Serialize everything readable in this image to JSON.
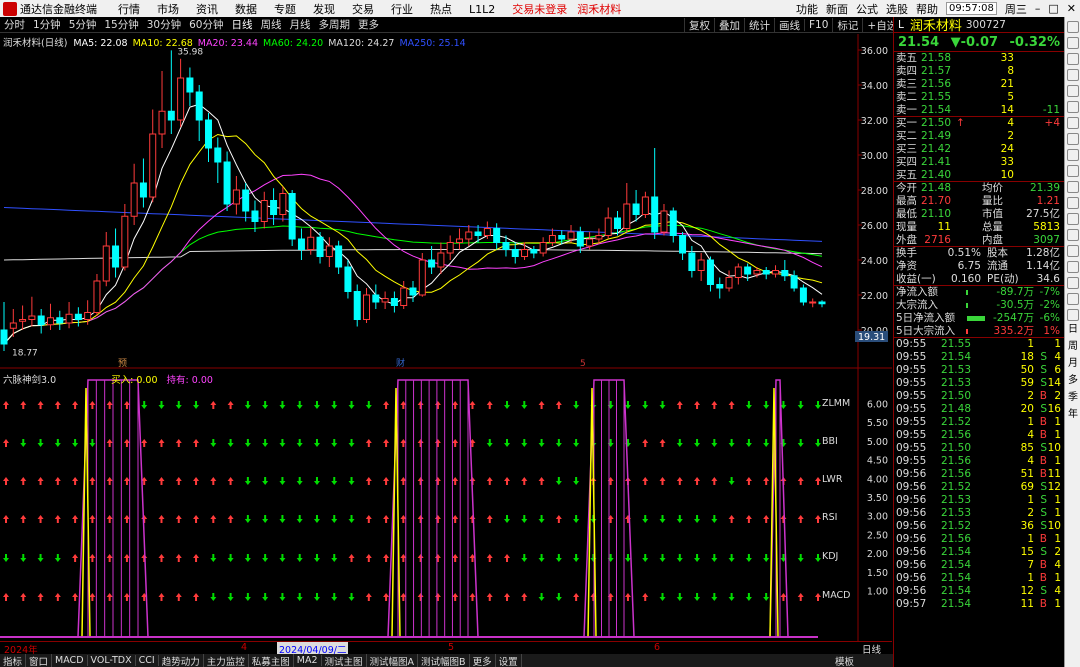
{
  "app": {
    "title": "通达信金融终端",
    "menu": [
      "行情",
      "市场",
      "资讯",
      "数据",
      "专题",
      "发现",
      "交易",
      "行业",
      "热点",
      "L1L2"
    ],
    "login": "交易未登录",
    "stock_name_top": "润禾材料",
    "right": [
      "功能",
      "新面",
      "公式",
      "选股",
      "帮助"
    ],
    "clock": "09:57:08",
    "weekday": "周三"
  },
  "toolbar": {
    "timeframes": [
      "分时",
      "1分钟",
      "5分钟",
      "15分钟",
      "30分钟",
      "60分钟",
      "日线",
      "周线",
      "月线",
      "多周期",
      "更多"
    ],
    "active": "日线",
    "right": [
      "复权",
      "叠加",
      "统计",
      "画线",
      "F10",
      "标记",
      "+自选",
      "返回"
    ]
  },
  "legend": {
    "name": "润禾材料(日线)",
    "ma": [
      {
        "label": "MA5: 22.08",
        "color": "#ffffff"
      },
      {
        "label": "MA10: 22.68",
        "color": "#ffff00"
      },
      {
        "label": "MA20: 23.44",
        "color": "#ff44ff"
      },
      {
        "label": "MA60: 24.20",
        "color": "#00ff00"
      },
      {
        "label": "MA120: 24.27",
        "color": "#dddddd"
      },
      {
        "label": "MA250: 25.14",
        "color": "#3050ff"
      }
    ]
  },
  "indicator": {
    "name": "六脉神剑3.0",
    "buy": "买入: 0.00",
    "hold": "持有: 0.00",
    "rows": [
      "ZLMM",
      "BBI",
      "LWR",
      "RSI",
      "KDJ",
      "MACD"
    ],
    "axis": [
      "6.00",
      "5.50",
      "5.00",
      "4.50",
      "4.00",
      "3.50",
      "3.00",
      "2.50",
      "2.00",
      "1.50",
      "1.00"
    ]
  },
  "price_axis": [
    "36.00",
    "34.00",
    "32.00",
    "30.00",
    "28.00",
    "26.00",
    "24.00",
    "22.00",
    "20.00"
  ],
  "price_marker": "19.31",
  "annotations": {
    "high": "35.98",
    "low": "18.77",
    "markers": [
      "预",
      "财",
      "5"
    ]
  },
  "dates": {
    "y2024": "2024年",
    "m4": "4",
    "sel": "2024/04/09/二",
    "m5": "5",
    "m6": "6",
    "period": "日线"
  },
  "bottom": [
    "指标",
    "窗口",
    "MACD",
    "VOL-TDX",
    "CCI",
    "趋势动力",
    "主力监控",
    "私募主图",
    "MA2",
    "测试主图",
    "测试幅图A",
    "测试幅图B",
    "更多",
    "设置"
  ],
  "bottom_right": "模板",
  "quote": {
    "tag": "L",
    "name": "润禾材料",
    "code": "300727",
    "price": "21.54",
    "change": "▼-0.07",
    "pct": "-0.32%",
    "asks": [
      [
        "卖五",
        "21.58",
        "33",
        ""
      ],
      [
        "卖四",
        "21.57",
        "8",
        ""
      ],
      [
        "卖三",
        "21.56",
        "21",
        ""
      ],
      [
        "卖二",
        "21.55",
        "5",
        ""
      ],
      [
        "卖一",
        "21.54",
        "14",
        "-11"
      ]
    ],
    "bids": [
      [
        "买一",
        "21.50",
        "4",
        "+4"
      ],
      [
        "买二",
        "21.49",
        "2",
        ""
      ],
      [
        "买三",
        "21.42",
        "24",
        ""
      ],
      [
        "买四",
        "21.41",
        "33",
        ""
      ],
      [
        "买五",
        "21.40",
        "10",
        ""
      ]
    ],
    "stats": [
      [
        "今开",
        "21.48",
        "均价",
        "21.39"
      ],
      [
        "最高",
        "21.70",
        "量比",
        "1.21"
      ],
      [
        "最低",
        "21.10",
        "市值",
        "27.5亿"
      ],
      [
        "现量",
        "11",
        "总量",
        "5813"
      ],
      [
        "外盘",
        "2716",
        "内盘",
        "3097"
      ]
    ],
    "stats2": [
      [
        "换手",
        "0.51%",
        "股本",
        "1.28亿"
      ],
      [
        "净资",
        "6.75",
        "流通",
        "1.14亿"
      ],
      [
        "收益(一)",
        "0.160",
        "PE(动)",
        "34.6"
      ]
    ],
    "flow": [
      [
        "净流入额",
        "-89.7万",
        "-7%"
      ],
      [
        "大宗流入",
        "-30.5万",
        "-2%"
      ],
      [
        "5日净流入额",
        "-2547万",
        "-6%"
      ],
      [
        "5日大宗流入",
        "335.2万",
        "1%"
      ]
    ],
    "ticks": [
      [
        "09:55",
        "21.55",
        "1",
        "",
        "1"
      ],
      [
        "09:55",
        "21.54",
        "18",
        "S",
        "4"
      ],
      [
        "09:55",
        "21.53",
        "50",
        "S",
        "6"
      ],
      [
        "09:55",
        "21.53",
        "59",
        "S",
        "14"
      ],
      [
        "09:55",
        "21.50",
        "2",
        "B",
        "2"
      ],
      [
        "09:55",
        "21.48",
        "20",
        "S",
        "16"
      ],
      [
        "09:55",
        "21.52",
        "1",
        "B",
        "1"
      ],
      [
        "09:55",
        "21.56",
        "4",
        "B",
        "1"
      ],
      [
        "09:55",
        "21.50",
        "85",
        "S",
        "10"
      ],
      [
        "09:55",
        "21.56",
        "4",
        "B",
        "1"
      ],
      [
        "09:56",
        "21.56",
        "51",
        "B",
        "11"
      ],
      [
        "09:56",
        "21.52",
        "69",
        "S",
        "12"
      ],
      [
        "09:56",
        "21.53",
        "1",
        "S",
        "1"
      ],
      [
        "09:56",
        "21.53",
        "2",
        "S",
        "1"
      ],
      [
        "09:56",
        "21.52",
        "36",
        "S",
        "10"
      ],
      [
        "09:56",
        "21.56",
        "1",
        "B",
        "1"
      ],
      [
        "09:56",
        "21.54",
        "15",
        "S",
        "2"
      ],
      [
        "09:56",
        "21.54",
        "7",
        "B",
        "4"
      ],
      [
        "09:56",
        "21.54",
        "1",
        "B",
        "1"
      ],
      [
        "09:56",
        "21.54",
        "12",
        "S",
        "4"
      ],
      [
        "09:57",
        "21.54",
        "11",
        "B",
        "1"
      ]
    ]
  },
  "side": {
    "icons": [
      "arrow-left-icon",
      "arrow-right-icon",
      "arrow-up-icon",
      "arrow-down-icon",
      "grid-icon",
      "chart-icon",
      "book-icon",
      "news-icon",
      "clock-icon",
      "info-icon",
      "fx-icon",
      "list-icon",
      "f10-icon",
      "bars-icon",
      "flag-icon",
      "move-icon",
      "pencil-icon",
      "f5-icon",
      "square-icon"
    ],
    "periods": [
      "日",
      "周",
      "月",
      "多",
      "季",
      "年"
    ]
  },
  "colors": {
    "up": "#ff3b3b",
    "down": "#00ffff",
    "bear_arrow": "#00dd00",
    "signal": "#cc33cc",
    "pulse": "#ffff00"
  }
}
